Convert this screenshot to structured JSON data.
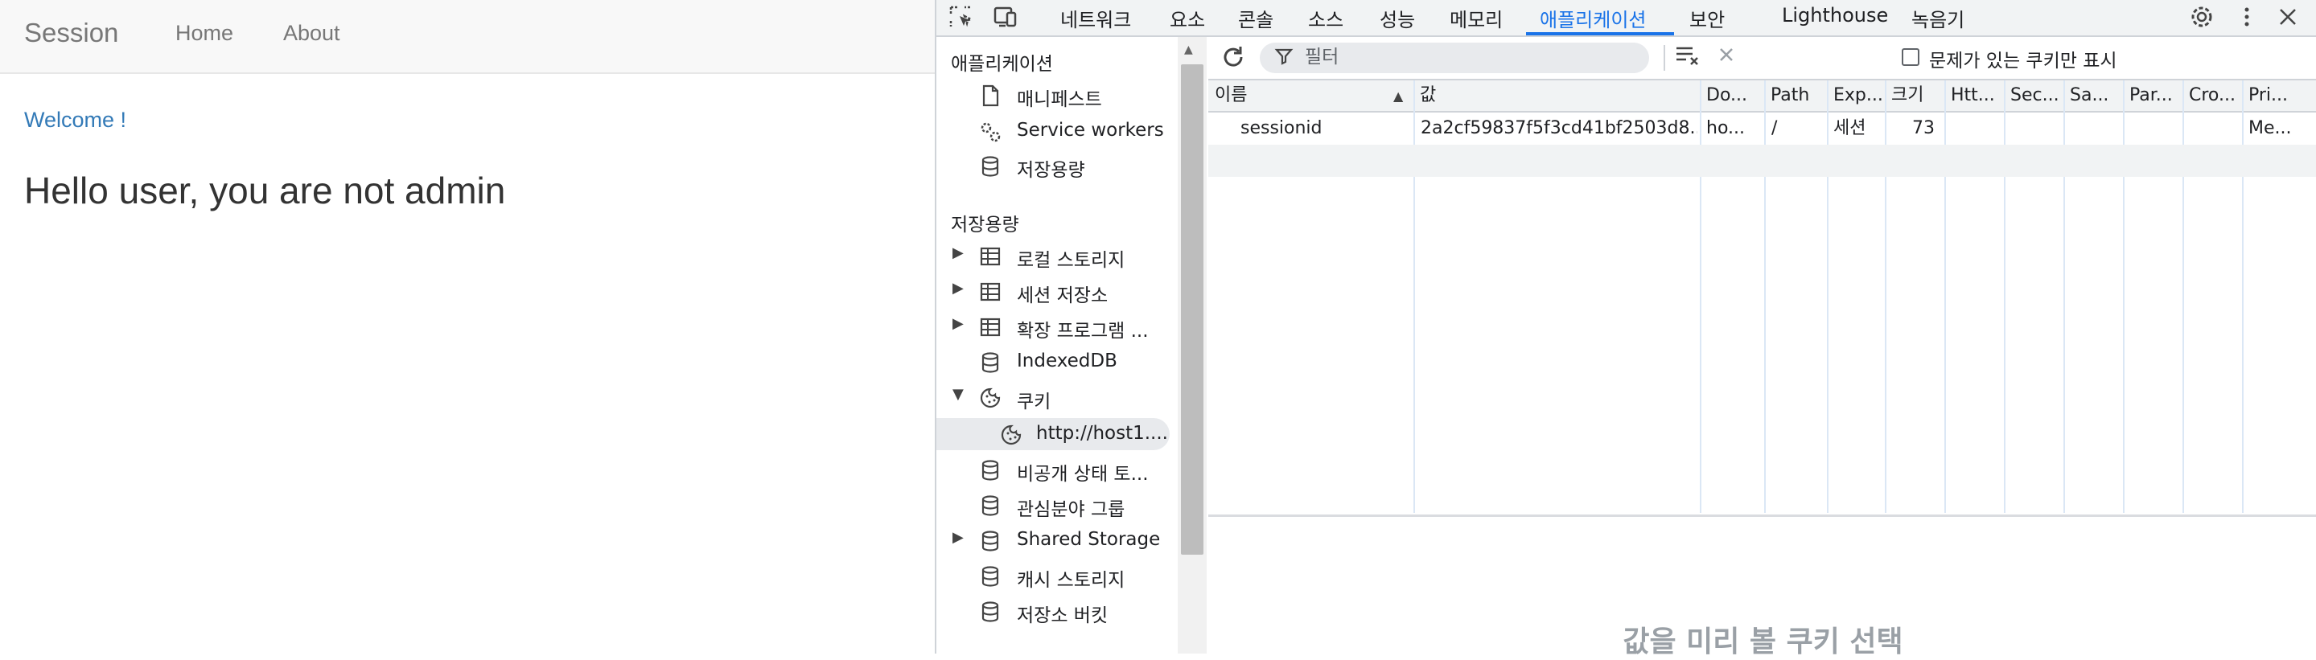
{
  "page": {
    "brand": "Session",
    "nav": [
      "Home",
      "About"
    ],
    "welcome": "Welcome !",
    "message": "Hello user, you are not admin"
  },
  "devtools": {
    "tabs": [
      "네트워크",
      "요소",
      "콘솔",
      "소스",
      "성능",
      "메모리",
      "애플리케이션",
      "보안",
      "Lighthouse",
      "녹음기"
    ],
    "active_tab": "애플리케이션",
    "toolbar_icons": [
      "inspect-icon",
      "device-toggle-icon",
      "settings-icon",
      "more-icon",
      "close-icon"
    ],
    "sidebar": {
      "section_app": "애플리케이션",
      "app_items": [
        "매니페스트",
        "Service workers",
        "저장용량"
      ],
      "section_storage": "저장용량",
      "storage_items": [
        "로컬 스토리지",
        "세션 저장소",
        "확장 프로그램 ...",
        "IndexedDB",
        "쿠키",
        "http://host1....",
        "비공개 상태 토...",
        "관심분야 그룹",
        "Shared Storage",
        "캐시 스토리지",
        "저장소 버킷"
      ]
    },
    "filter": {
      "placeholder": "필터",
      "issues_only_label": "문제가 있는 쿠키만 표시"
    },
    "cookie_table": {
      "columns": [
        "이름",
        "값",
        "Do...",
        "Path",
        "Exp...",
        "크기",
        "Htt...",
        "Sec...",
        "Sa...",
        "Par...",
        "Cro...",
        "Pri..."
      ],
      "rows": [
        [
          "sessionid",
          "2a2cf59837f5f3cd41bf2503d8...",
          "ho...",
          "/",
          "세션",
          "73",
          "",
          "",
          "",
          "",
          "",
          "Me..."
        ]
      ]
    },
    "preview_message": "값을 미리 볼 쿠키 선택",
    "colors": {
      "accent": "#1a73e8",
      "link": "#337ab7"
    }
  }
}
